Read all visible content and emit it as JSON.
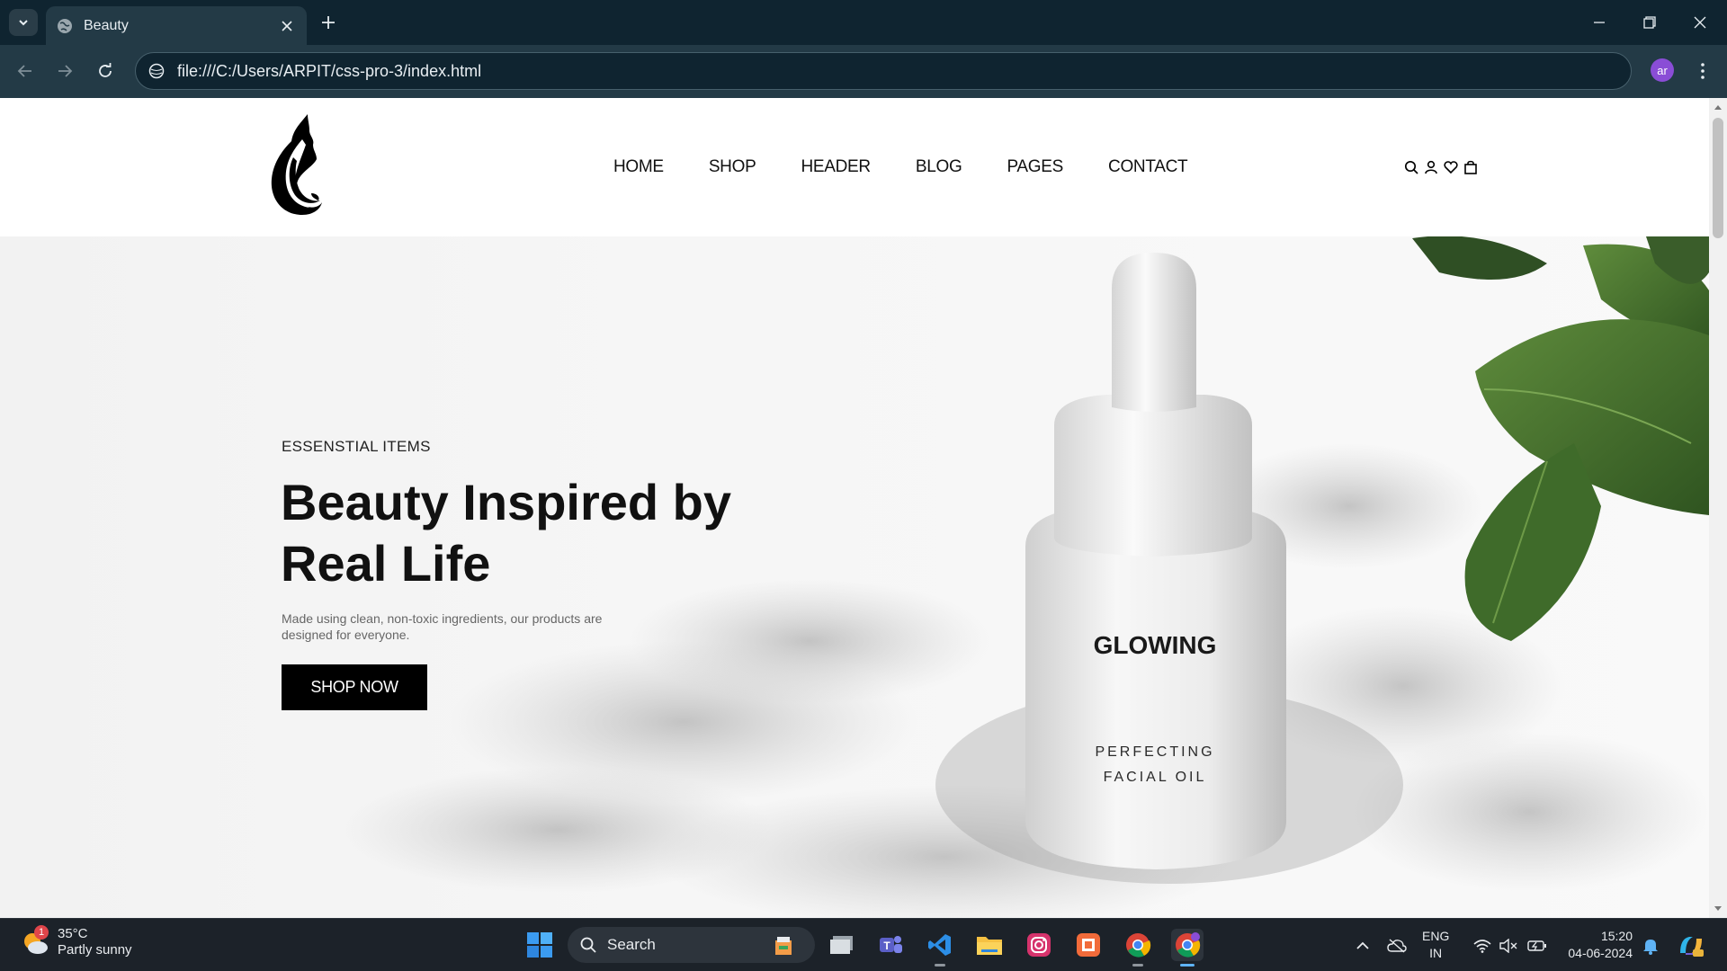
{
  "browser": {
    "tab_title": "Beauty",
    "url": "file:///C:/Users/ARPIT/css-pro-3/index.html",
    "profile_initials": "ar"
  },
  "site": {
    "nav": [
      "HOME",
      "SHOP",
      "HEADER",
      "BLOG",
      "PAGES",
      "CONTACT"
    ],
    "hero": {
      "subtitle": "ESSENSTIAL ITEMS",
      "title_line1": "Beauty Inspired by",
      "title_line2": "Real Life",
      "description": "Made using clean, non-toxic ingredients, our products are designed for everyone.",
      "cta": "SHOP NOW",
      "bottle_brand": "GLOWING",
      "bottle_line1": "PERFECTING",
      "bottle_line2": "FACIAL OIL"
    }
  },
  "taskbar": {
    "weather_temp": "35°C",
    "weather_desc": "Partly sunny",
    "weather_badge": "1",
    "search_label": "Search",
    "lang_line1": "ENG",
    "lang_line2": "IN",
    "time": "15:20",
    "date": "04-06-2024"
  },
  "colors": {
    "chrome_dark": "#0f2430",
    "chrome_mid": "#233a46",
    "taskbar": "#1c2229",
    "cta": "#000000",
    "leaf": "#3f6b2a"
  }
}
